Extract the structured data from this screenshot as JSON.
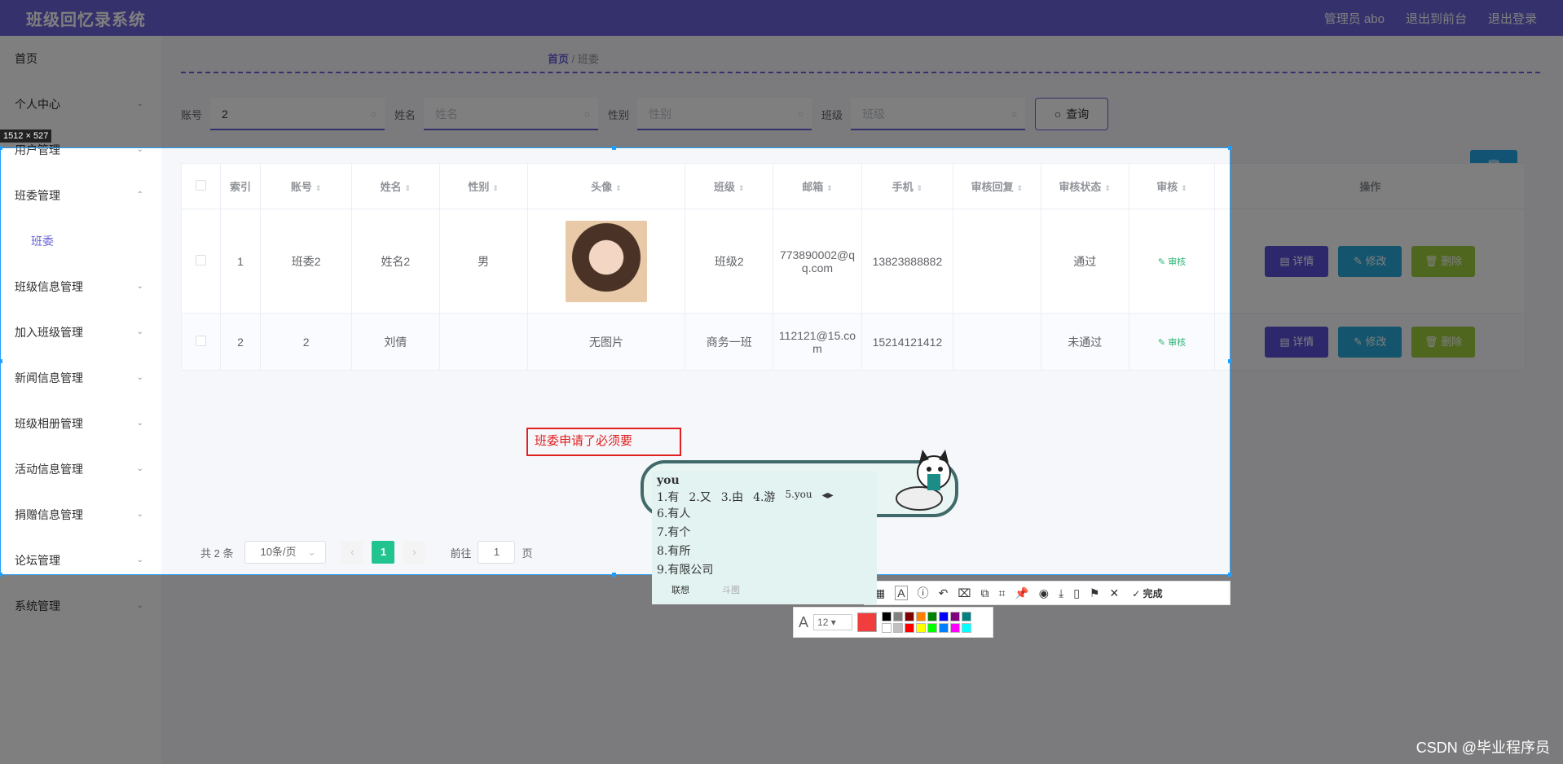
{
  "header": {
    "title": "班级回忆录系统",
    "admin": "管理员 abo",
    "back_to_front": "退出到前台",
    "logout": "退出登录"
  },
  "sidebar": {
    "items": [
      {
        "label": "首页"
      },
      {
        "label": "个人中心"
      },
      {
        "label": "用户管理"
      },
      {
        "label": "班委管理"
      },
      {
        "label": "班委"
      },
      {
        "label": "班级信息管理"
      },
      {
        "label": "加入班级管理"
      },
      {
        "label": "新闻信息管理"
      },
      {
        "label": "班级相册管理"
      },
      {
        "label": "活动信息管理"
      },
      {
        "label": "捐赠信息管理"
      },
      {
        "label": "论坛管理"
      },
      {
        "label": "系统管理"
      }
    ]
  },
  "breadcrumb": {
    "home": "首页",
    "sep": "/",
    "current": "班委"
  },
  "search": {
    "fields": [
      {
        "label": "账号",
        "value": "2",
        "placeholder": ""
      },
      {
        "label": "姓名",
        "value": "",
        "placeholder": "姓名"
      },
      {
        "label": "性别",
        "value": "",
        "placeholder": "性别"
      },
      {
        "label": "班级",
        "value": "",
        "placeholder": "班级"
      }
    ],
    "query_label": "查询"
  },
  "table": {
    "headers": [
      "索引",
      "账号",
      "姓名",
      "性别",
      "头像",
      "班级",
      "邮箱",
      "手机",
      "审核回复",
      "审核状态",
      "审核",
      "操作"
    ],
    "rows": [
      {
        "index": "1",
        "account": "班委2",
        "name": "姓名2",
        "gender": "男",
        "avatar": "",
        "class": "班级2",
        "email": "773890002@qq.com",
        "phone": "13823888882",
        "reply": "",
        "status": "通过",
        "audit": "审核"
      },
      {
        "index": "2",
        "account": "2",
        "name": "刘倩",
        "gender": "",
        "avatar": "无图片",
        "class": "商务一班",
        "email": "112121@15.com",
        "phone": "15214121412",
        "reply": "",
        "status": "未通过",
        "audit": "审核"
      }
    ],
    "actions": {
      "detail": "详情",
      "edit": "修改",
      "delete": "删除"
    }
  },
  "pager": {
    "total": "共 2 条",
    "page_size": "10条/页",
    "current_page": "1",
    "goto_label": "前往",
    "goto_value": "1",
    "page_unit": "页"
  },
  "capture": {
    "size_label": "1512 × 527",
    "annotation_text": "班委申请了必须要",
    "done_label": "完成",
    "font_size": "12",
    "current_color": "#f03d3d",
    "swatches": [
      "#000000",
      "#808080",
      "#800000",
      "#ff8000",
      "#008000",
      "#0000ff",
      "#800080",
      "#008080",
      "#ffffff",
      "#c0c0c0",
      "#ff0000",
      "#ffff00",
      "#00ff00",
      "#0080ff",
      "#ff00ff",
      "#00ffff"
    ]
  },
  "ime": {
    "composition": "you",
    "row1": [
      "1.有",
      "2.又",
      "3.由",
      "4.游",
      "5.you"
    ],
    "candidates": [
      "6.有人",
      "7.有个",
      "8.有所",
      "9.有限公司"
    ],
    "tab_active": "联想",
    "tab_inactive": "斗图"
  },
  "watermark": "CSDN @毕业程序员"
}
